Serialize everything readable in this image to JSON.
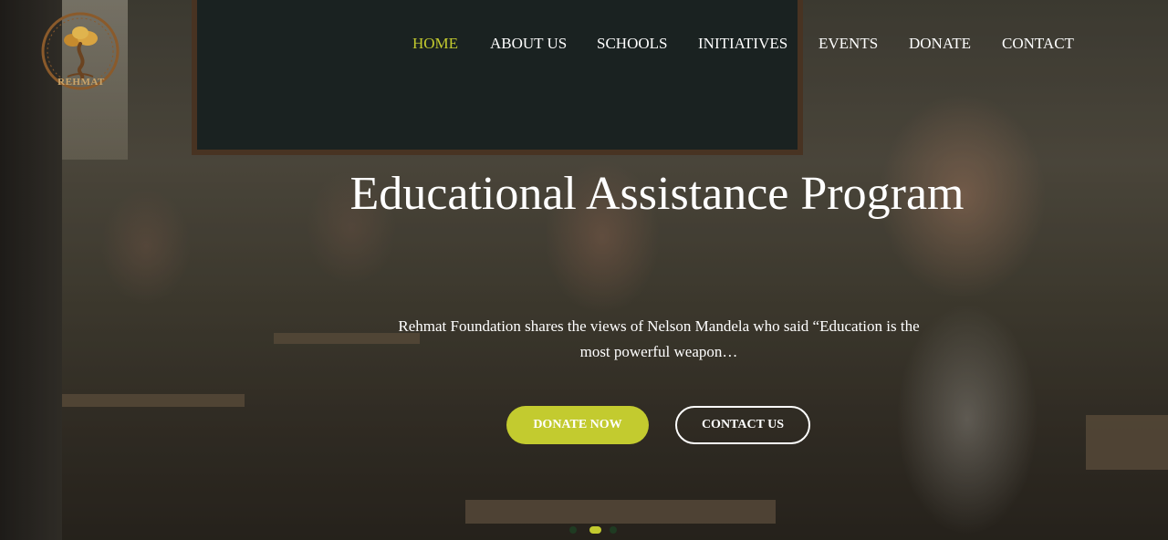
{
  "brand": {
    "logo_text": "REHMAT"
  },
  "nav": {
    "items": [
      {
        "label": "HOME",
        "active": true
      },
      {
        "label": "ABOUT US",
        "active": false
      },
      {
        "label": "SCHOOLS",
        "active": false
      },
      {
        "label": "INITIATIVES",
        "active": false
      },
      {
        "label": "EVENTS",
        "active": false
      },
      {
        "label": "DONATE",
        "active": false
      },
      {
        "label": "CONTACT",
        "active": false
      }
    ]
  },
  "hero": {
    "title": "Educational Assistance Program",
    "subtitle": "Rehmat Foundation shares the views of Nelson Mandela who said “Education is the most powerful weapon…",
    "primary_button": "DONATE NOW",
    "secondary_button": "CONTACT US",
    "slider": {
      "count": 3,
      "active_index": 1
    }
  },
  "colors": {
    "accent": "#c3cb2f",
    "text": "#ffffff",
    "logo": "#8a5a2b"
  }
}
